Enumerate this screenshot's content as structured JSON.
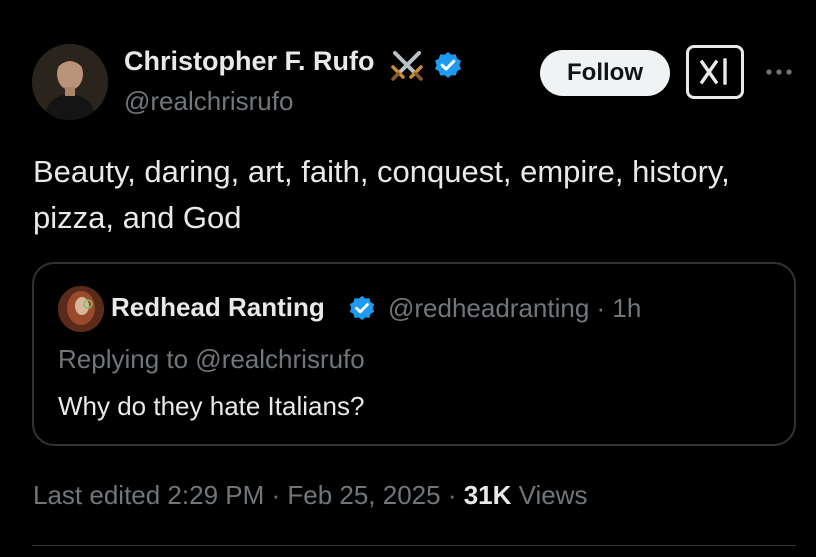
{
  "tweet": {
    "author": {
      "name": "Christopher F. Rufo",
      "handle": "@realchrisrufo",
      "emoji_icon": "crossed-swords-icon",
      "verified_icon": "verified-badge-icon"
    },
    "follow_label": "Follow",
    "grok_icon": "grok-icon",
    "more_icon": "more-options-icon",
    "text": "Beauty, daring, art, faith, conquest, empire, history, pizza, and God",
    "quoted": {
      "name": "Redhead Ranting",
      "handle_time": "@redheadranting · 1h",
      "verified_icon": "verified-badge-icon",
      "replying_to": "Replying to @realchrisrufo",
      "text": "Why do they hate Italians?"
    },
    "footer": {
      "meta": "Last edited 2:29 PM · Feb 25, 2025 · ",
      "views_count": "31K",
      "views_label": " Views"
    }
  },
  "colors": {
    "background": "#000000",
    "primary_text": "#e7e9ea",
    "secondary_text": "#71767b",
    "verified_blue": "#1d9bf0",
    "border": "#2f3336",
    "follow_button_bg": "#eff3f4"
  }
}
